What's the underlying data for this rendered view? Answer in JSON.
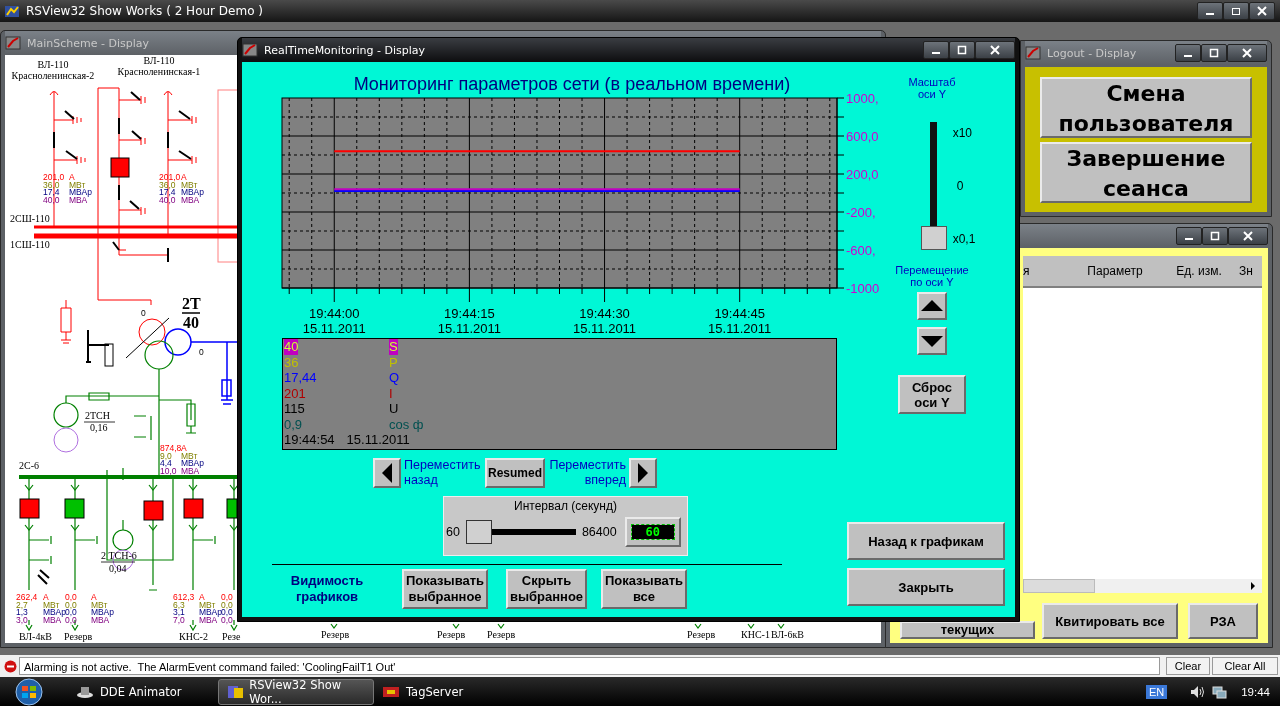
{
  "app": {
    "title": "RSView32 Show Works ( 2 Hour Demo )"
  },
  "main_scheme": {
    "title": "MainScheme - Display",
    "feeders_110": [
      {
        "name": "ВЛ-110",
        "subtitle": "Красноленинская-2",
        "readings": [
          {
            "kind": "current",
            "value": "201,0",
            "unit": "А"
          },
          {
            "kind": "active",
            "value": "36,0",
            "unit": "МВт"
          },
          {
            "kind": "reactive",
            "value": "17,4",
            "unit": "МВАр"
          },
          {
            "kind": "apparent",
            "value": "40,0",
            "unit": "МВА"
          }
        ]
      },
      {
        "name": "ВЛ-110",
        "subtitle": "Красноленинская-1",
        "readings": [
          {
            "kind": "current",
            "value": "201,0",
            "unit": "А"
          },
          {
            "kind": "active",
            "value": "36,0",
            "unit": "МВт"
          },
          {
            "kind": "reactive",
            "value": "17,4",
            "unit": "МВАр"
          },
          {
            "kind": "apparent",
            "value": "40,0",
            "unit": "МВА"
          }
        ]
      }
    ],
    "sectional_breaker_closed": true,
    "buses_110": [
      "2СШ-110",
      "1СШ-110"
    ],
    "transformer": {
      "name": "2T",
      "rating": "40",
      "terminals": [
        "0",
        "0"
      ]
    },
    "aux_transformer": {
      "name": "2ТСН",
      "rating": "0,16"
    },
    "transformer_readings": [
      {
        "kind": "current",
        "value": "874,8",
        "unit": "А"
      },
      {
        "kind": "active",
        "value": "9,0",
        "unit": "МВт"
      },
      {
        "kind": "reactive",
        "value": "4,4",
        "unit": "МВАр"
      },
      {
        "kind": "apparent",
        "value": "10,0",
        "unit": "МВА"
      }
    ],
    "bus_6": "2С-6",
    "aux_transformer_6": {
      "name": "2 ТСН-6",
      "rating": "0,04",
      "breaker_closed": true
    },
    "feeders_6": [
      {
        "label": "ВЛ-4кВ",
        "breaker_closed": true,
        "readings": [
          {
            "kind": "current",
            "value": "262,4",
            "unit": "А"
          },
          {
            "kind": "active",
            "value": "2,7",
            "unit": "МВт"
          },
          {
            "kind": "reactive",
            "value": "1,3",
            "unit": "МВАр"
          },
          {
            "kind": "apparent",
            "value": "3,0",
            "unit": "МВА"
          }
        ]
      },
      {
        "label": "Резерв",
        "breaker_closed": false,
        "readings": [
          {
            "kind": "current",
            "value": "0,0",
            "unit": "А"
          },
          {
            "kind": "active",
            "value": "0,0",
            "unit": "МВт"
          },
          {
            "kind": "reactive",
            "value": "0,0",
            "unit": "МВАр"
          },
          {
            "kind": "apparent",
            "value": "0,0",
            "unit": "МВА"
          }
        ]
      },
      {
        "label": "КНС-2",
        "breaker_closed": true,
        "readings": [
          {
            "kind": "current",
            "value": "612,3",
            "unit": "А"
          },
          {
            "kind": "active",
            "value": "6,3",
            "unit": "МВт"
          },
          {
            "kind": "reactive",
            "value": "3,1",
            "unit": "МВАр"
          },
          {
            "kind": "apparent",
            "value": "7,0",
            "unit": "МВА"
          }
        ]
      },
      {
        "label": "Резе",
        "breaker_closed": false,
        "readings": [
          {
            "kind": "current",
            "value": "0,0"
          },
          {
            "kind": "active",
            "value": "0,0"
          },
          {
            "kind": "reactive",
            "value": "0,0"
          },
          {
            "kind": "apparent",
            "value": "0,0"
          }
        ]
      }
    ],
    "bottom_labels": [
      "Резерв",
      "Резерв",
      "Резерв",
      "Резерв",
      "КНС-1",
      "ВЛ-6кВ"
    ]
  },
  "monitoring": {
    "title": "RealTimeMonitoring - Display",
    "heading": "Мониторинг параметров сети (в реальном времени)",
    "chart_data": {
      "type": "line",
      "grid": true,
      "categories": [
        "19:44:00 15.11.2011",
        "19:44:15 15.11.2011",
        "19:44:30 15.11.2011",
        "19:44:45 15.11.2011"
      ],
      "ylim": [
        -1000,
        1000
      ],
      "yticks": [
        {
          "value": 1000,
          "label": "1000,"
        },
        {
          "value": 600,
          "label": "600,0"
        },
        {
          "value": 200,
          "label": "200,0"
        },
        {
          "value": -200,
          "label": "-200,"
        },
        {
          "value": -600,
          "label": "-600,"
        },
        {
          "value": -1000,
          "label": "-1000"
        }
      ],
      "series": [
        {
          "color": "#ff0000",
          "values": [
            440,
            440,
            440,
            440
          ]
        },
        {
          "color": "#0000ff",
          "values": [
            20,
            20,
            20,
            20
          ]
        },
        {
          "color": "#c000c0",
          "values": [
            40,
            40,
            40,
            40
          ]
        }
      ]
    },
    "legend": [
      {
        "value": "40",
        "name": "S",
        "color": "#c000c0",
        "selected": true
      },
      {
        "value": "36",
        "name": "P",
        "color": "#c0c000",
        "selected": false
      },
      {
        "value": "17,44",
        "name": "Q",
        "color": "#0000ff",
        "selected": false
      },
      {
        "value": "201",
        "name": "I",
        "color": "#b00000",
        "selected": false
      },
      {
        "value": "115",
        "name": "U",
        "color": "#000000",
        "selected": false
      },
      {
        "value": "0,9",
        "name": "cos ф",
        "color": "#005050",
        "selected": false
      }
    ],
    "legend_time": "19:44:54",
    "legend_date": "15.11.2011",
    "back_label": "Переместить назад",
    "pause_button": "Resumed",
    "forward_label": "Переместить вперед",
    "interval": {
      "title": "Интервал (секунд)",
      "min": "60",
      "max": "86400",
      "level": 0,
      "display": "60"
    },
    "visibility_label": "Видимость графиков",
    "visibility_buttons": [
      "Показывать выбранное",
      "Скрыть выбранное",
      "Показывать все"
    ],
    "scale": {
      "title": "Масштаб оси Y",
      "level": 0,
      "ticks": [
        "x10",
        "0",
        "x0,1"
      ]
    },
    "shift_label": "Перемещение по оси Y",
    "reset_button": "Сброс оси Y",
    "nav_buttons": [
      "Назад к графикам",
      "Закрыть"
    ]
  },
  "logout": {
    "title": "Logout - Display",
    "buttons": [
      "Смена пользователя",
      "Завершение сеанса"
    ]
  },
  "alarms": {
    "columns": [
      "я",
      "Параметр",
      "Ед. изм.",
      "Зн"
    ],
    "buttons": [
      "текущих",
      "Квитировать все",
      "РЗА"
    ]
  },
  "status_bar": {
    "message": "Alarming is not active.  The AlarmEvent command failed: 'CoolingFailT1 Out'",
    "buttons": [
      "Clear",
      "Clear All"
    ]
  },
  "taskbar": {
    "items": [
      {
        "label": "DDE Animator",
        "selected": false
      },
      {
        "label": "RSView32 Show Wor...",
        "selected": true
      },
      {
        "label": "TagServer",
        "selected": false
      }
    ],
    "language": "EN",
    "clock": "19:44"
  }
}
